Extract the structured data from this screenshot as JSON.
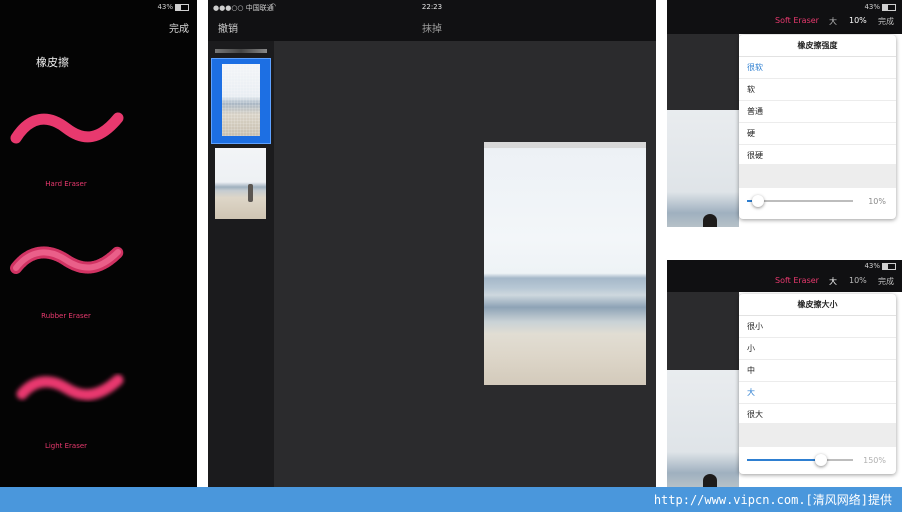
{
  "panel1": {
    "status": {
      "battery": "43%"
    },
    "done_label": "完成",
    "title": "橡皮擦",
    "erasers": [
      {
        "name": "Hard Eraser"
      },
      {
        "name": "Rubber Eraser"
      },
      {
        "name": "Light Eraser"
      }
    ]
  },
  "panel2": {
    "status": {
      "carrier": "●●●○○ 中国联通",
      "time": "22:23"
    },
    "cancel_label": "撤销",
    "title": "抹掉"
  },
  "panel3": {
    "status": {
      "battery": "43%"
    },
    "toolbar": {
      "mode": "Soft Eraser",
      "size": "大",
      "percent": "10%",
      "done": "完成"
    },
    "popover": {
      "title": "橡皮擦强度",
      "options": [
        "很软",
        "软",
        "普通",
        "硬",
        "很硬"
      ],
      "selected_index": 0,
      "slider_value_label": "10%",
      "slider_fraction": 0.1
    }
  },
  "panel4": {
    "status": {
      "battery": "43%"
    },
    "toolbar": {
      "mode": "Soft Eraser",
      "size": "大",
      "percent": "10%",
      "done": "完成"
    },
    "popover": {
      "title": "橡皮擦大小",
      "options": [
        "很小",
        "小",
        "中",
        "大",
        "很大"
      ],
      "selected_index": 3,
      "slider_value_label": "150%",
      "slider_fraction": 0.7
    }
  },
  "footer": {
    "text": "http://www.vipcn.com.[清风网络]提供"
  },
  "colors": {
    "accent_pink": "#e8396e",
    "accent_blue": "#2e7fd1",
    "footer_bg": "#4a97dc"
  }
}
